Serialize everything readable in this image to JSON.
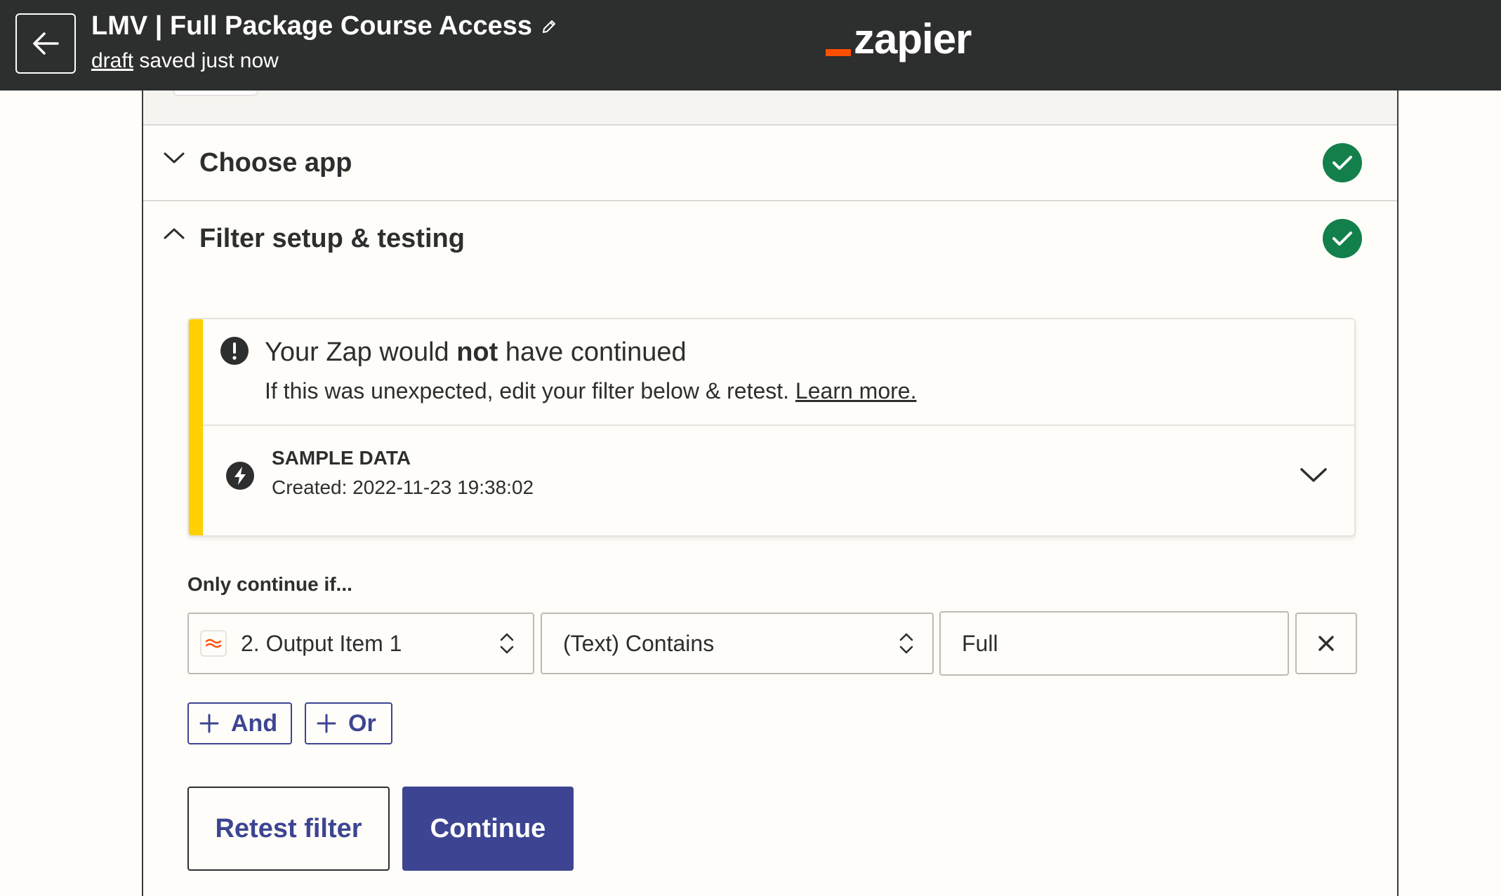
{
  "header": {
    "zap_title": "LMV | Full Package Course Access",
    "draft_link": "draft",
    "saved_status": "saved just now",
    "logo_text": "zapier",
    "accent_color": "#ff4f00"
  },
  "sections": {
    "choose_app": {
      "title": "Choose app",
      "status": "complete"
    },
    "filter_setup": {
      "title": "Filter setup & testing",
      "status": "complete"
    }
  },
  "alert": {
    "title_before": "Your Zap would ",
    "title_bold": "not",
    "title_after": " have continued",
    "subtitle": "If this was unexpected, edit your filter below & retest. ",
    "learn_more": "Learn more.",
    "sample_label": "SAMPLE DATA",
    "sample_created": "Created: 2022-11-23 19:38:02",
    "stripe_color": "#ffd000"
  },
  "filter": {
    "only_continue_label": "Only continue if...",
    "rule": {
      "field": "2. Output Item 1",
      "operator": "(Text) Contains",
      "value": "Full"
    },
    "and_label": "And",
    "or_label": "Or"
  },
  "actions": {
    "retest_label": "Retest filter",
    "continue_label": "Continue",
    "primary_color": "#3d4592"
  },
  "icons": [
    "arrow-left-icon",
    "pencil-icon",
    "chevron-down-icon",
    "chevron-up-icon",
    "check-icon",
    "exclamation-icon",
    "bolt-icon",
    "formatter-icon",
    "updown-icon",
    "close-icon",
    "plus-icon"
  ]
}
